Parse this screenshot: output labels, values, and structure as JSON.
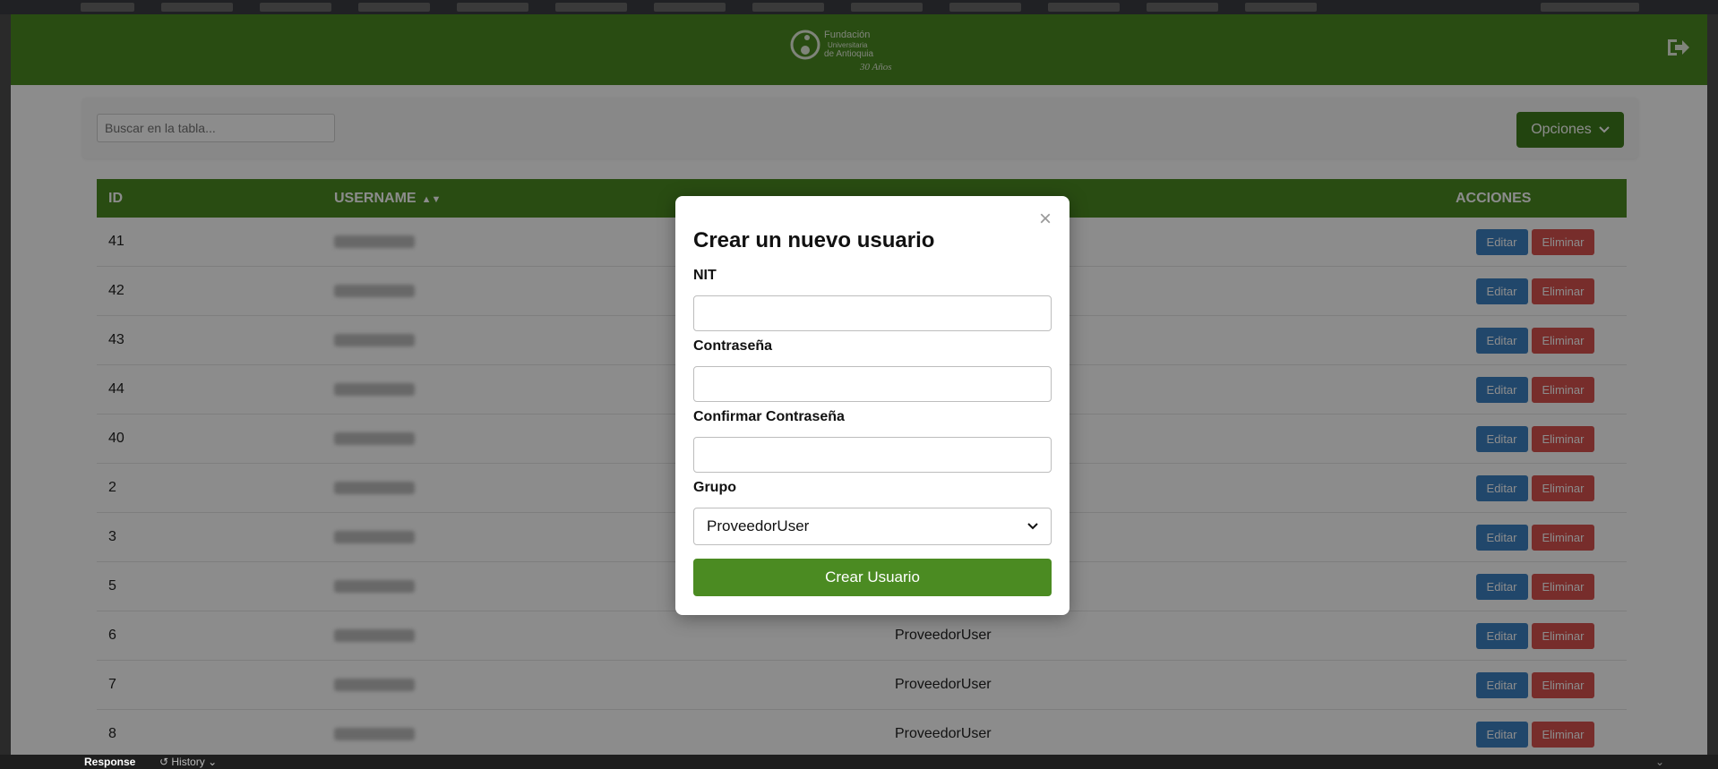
{
  "header": {
    "logo_alt": "Fundación Universitaria de Antioquia 30 Años",
    "logo_line1": "Fundación",
    "logo_line2": "Universitaria",
    "logo_line3": "de Antioquia",
    "logo_line4": "30 Años"
  },
  "toolbar": {
    "search_placeholder": "Buscar en la tabla...",
    "options_label": "Opciones"
  },
  "table": {
    "columns": {
      "id": "ID",
      "username": "USERNAME",
      "actions": "ACCIONES"
    },
    "edit_label": "Editar",
    "delete_label": "Eliminar",
    "rows": [
      {
        "id": "41",
        "group": ""
      },
      {
        "id": "42",
        "group": ""
      },
      {
        "id": "43",
        "group": ""
      },
      {
        "id": "44",
        "group": ""
      },
      {
        "id": "40",
        "group": ""
      },
      {
        "id": "2",
        "group": ""
      },
      {
        "id": "3",
        "group": ""
      },
      {
        "id": "5",
        "group": ""
      },
      {
        "id": "6",
        "group": "ProveedorUser"
      },
      {
        "id": "7",
        "group": "ProveedorUser"
      },
      {
        "id": "8",
        "group": "ProveedorUser"
      }
    ]
  },
  "modal": {
    "close": "×",
    "title": "Crear un nuevo usuario",
    "nit_label": "NIT",
    "password_label": "Contraseña",
    "confirm_label": "Confirmar Contraseña",
    "group_label": "Grupo",
    "group_value": "ProveedorUser",
    "submit_label": "Crear Usuario"
  },
  "devtools": {
    "response_tab": "Response",
    "history_tab": "History"
  },
  "colors": {
    "brand_green": "#4b8b22",
    "edit_blue": "#3d82c4",
    "delete_red": "#d9534f"
  }
}
